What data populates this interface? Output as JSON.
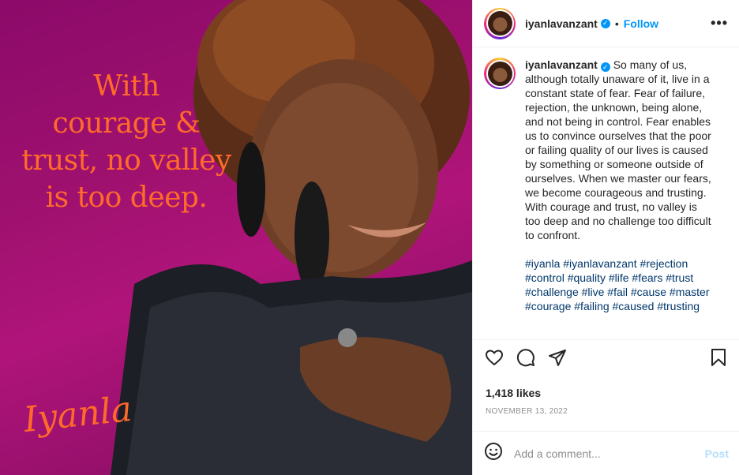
{
  "media": {
    "quote_lines": [
      "With",
      "courage &",
      "trust, no valley",
      "is too deep."
    ],
    "signature": "Iyanla",
    "background_color": "#a0116f",
    "accent_color": "#ff6a2a"
  },
  "header": {
    "username": "iyanlavanzant",
    "separator": "•",
    "follow_label": "Follow",
    "more_icon": "more-horizontal-icon"
  },
  "caption": {
    "username": "iyanlavanzant",
    "text": "So many of us, although totally unaware of it, live in a constant state of fear. Fear of failure, rejection, the unknown, being alone, and not being in control. Fear enables us to convince ourselves that the poor or failing quality of our lives is caused by something or someone outside of ourselves. When we master our fears, we become courageous and trusting. With courage and trust, no valley is too deep and no challenge too difficult to confront.",
    "hashtags": "#iyanla #iyanlavanzant #rejection #control #quality #life #fears #trust #challenge #live #fail #cause #master #courage #failing #caused #trusting"
  },
  "actions": {
    "icons": [
      "heart-icon",
      "comment-icon",
      "share-icon",
      "bookmark-icon"
    ]
  },
  "likes": "1,418 likes",
  "date": "NOVEMBER 13, 2022",
  "comment": {
    "placeholder": "Add a comment...",
    "post_label": "Post",
    "emoji_icon": "emoji-icon"
  },
  "colors": {
    "link_blue": "#0095f6",
    "hashtag_blue": "#00376b",
    "muted": "#8e8e8e"
  }
}
